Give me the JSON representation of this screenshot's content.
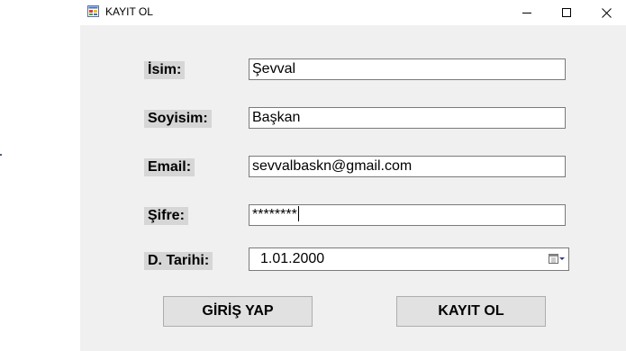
{
  "window": {
    "title": "KAYIT OL",
    "controls": {
      "minimize_icon": "minimize-icon",
      "maximize_icon": "maximize-icon",
      "close_icon": "close-icon"
    }
  },
  "form": {
    "name": {
      "label": "İsim:",
      "value": "Şevval"
    },
    "surname": {
      "label": "Soyisim:",
      "value": "Başkan"
    },
    "email": {
      "label": "Email:",
      "value": "sevvalbaskn@gmail.com"
    },
    "password": {
      "label": "Şifre:",
      "value": "********"
    },
    "birthdate": {
      "label": "D. Tarihi:",
      "value": "1.01.2000",
      "dropdown_icon": "calendar-dropdown-icon"
    }
  },
  "buttons": {
    "login": "GİRİŞ YAP",
    "register": "KAYIT OL"
  },
  "colors": {
    "client_bg": "#f0f0f0",
    "label_bg": "#d6d6d6",
    "button_bg": "#e1e1e1",
    "button_border": "#adadad",
    "textbox_border": "#7a7a7a"
  }
}
